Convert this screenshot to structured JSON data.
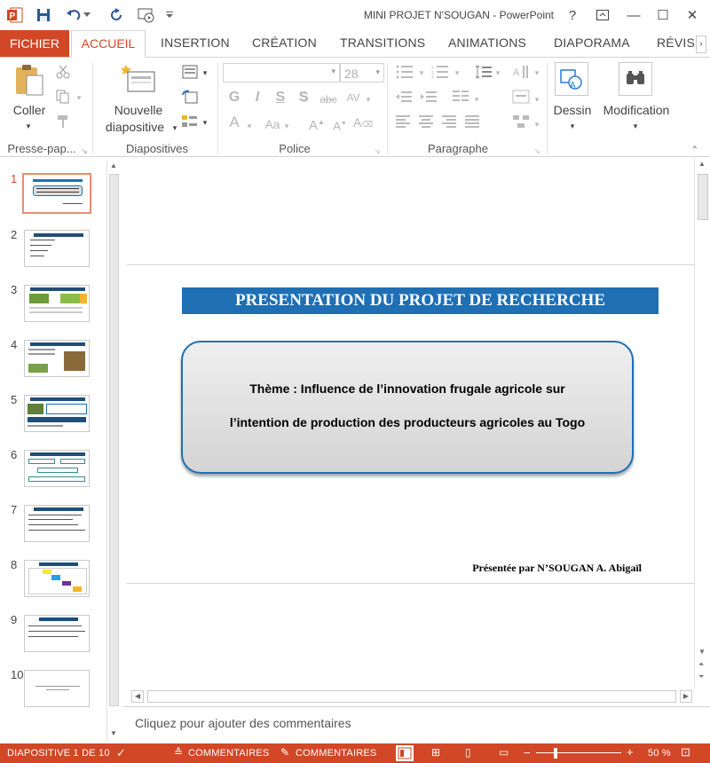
{
  "window": {
    "title": "MINI PROJET N'SOUGAN - PowerPoint",
    "help_glyph": "?",
    "min_glyph": "—",
    "max_glyph": "☐",
    "close_glyph": "✕"
  },
  "tabs": [
    "FICHIER",
    "ACCUEIL",
    "INSERTION",
    "CRÉATION",
    "TRANSITIONS",
    "ANIMATIONS",
    "DIAPORAMA",
    "RÉVISI"
  ],
  "ribbon": {
    "coller": "Coller",
    "nouvelle": "Nouvelle",
    "diapositive": "diapositive",
    "font_size": "28",
    "bold": "G",
    "italic": "I",
    "underline": "S",
    "shadow": "S",
    "strike": "abc",
    "spacing": "AV",
    "fontcolor": "A",
    "case": "Aa",
    "dessin": "Dessin",
    "modification": "Modification",
    "groups": [
      "Presse-pap...",
      "Diapositives",
      "Police",
      "Paragraphe"
    ]
  },
  "thumbnails": [
    "1",
    "2",
    "3",
    "4",
    "5",
    "6",
    "7",
    "8",
    "9",
    "10"
  ],
  "slide": {
    "banner": "PRESENTATION DU PROJET DE RECHERCHE",
    "theme_line1": "Thème : Influence de l’innovation frugale agricole sur",
    "theme_line2": "l’intention de production des producteurs agricoles au Togo",
    "presenter": "Présentée par N’SOUGAN A. Abigaïl",
    "banner_color": "#1f6fb4"
  },
  "notes": {
    "placeholder": "Cliquez pour ajouter des commentaires"
  },
  "status": {
    "slide_info": "DIAPOSITIVE 1 DE 10",
    "notes1": "COMMENTAIRES",
    "notes2": "COMMENTAIRES",
    "zoom": "50 %",
    "accent": "#d24726"
  }
}
